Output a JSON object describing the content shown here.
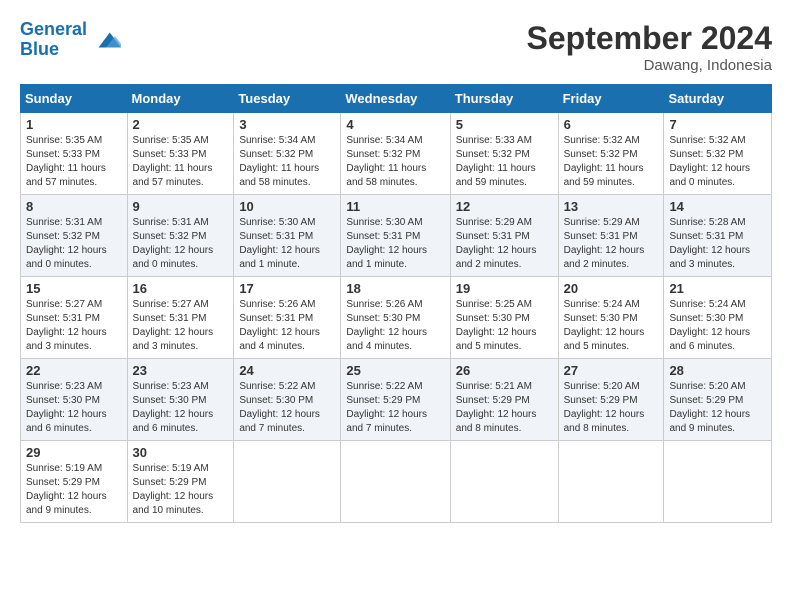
{
  "header": {
    "logo_line1": "General",
    "logo_line2": "Blue",
    "month": "September 2024",
    "location": "Dawang, Indonesia"
  },
  "days_of_week": [
    "Sunday",
    "Monday",
    "Tuesday",
    "Wednesday",
    "Thursday",
    "Friday",
    "Saturday"
  ],
  "weeks": [
    [
      {
        "day": "1",
        "info": "Sunrise: 5:35 AM\nSunset: 5:33 PM\nDaylight: 11 hours\nand 57 minutes."
      },
      {
        "day": "2",
        "info": "Sunrise: 5:35 AM\nSunset: 5:33 PM\nDaylight: 11 hours\nand 57 minutes."
      },
      {
        "day": "3",
        "info": "Sunrise: 5:34 AM\nSunset: 5:32 PM\nDaylight: 11 hours\nand 58 minutes."
      },
      {
        "day": "4",
        "info": "Sunrise: 5:34 AM\nSunset: 5:32 PM\nDaylight: 11 hours\nand 58 minutes."
      },
      {
        "day": "5",
        "info": "Sunrise: 5:33 AM\nSunset: 5:32 PM\nDaylight: 11 hours\nand 59 minutes."
      },
      {
        "day": "6",
        "info": "Sunrise: 5:32 AM\nSunset: 5:32 PM\nDaylight: 11 hours\nand 59 minutes."
      },
      {
        "day": "7",
        "info": "Sunrise: 5:32 AM\nSunset: 5:32 PM\nDaylight: 12 hours\nand 0 minutes."
      }
    ],
    [
      {
        "day": "8",
        "info": "Sunrise: 5:31 AM\nSunset: 5:32 PM\nDaylight: 12 hours\nand 0 minutes."
      },
      {
        "day": "9",
        "info": "Sunrise: 5:31 AM\nSunset: 5:32 PM\nDaylight: 12 hours\nand 0 minutes."
      },
      {
        "day": "10",
        "info": "Sunrise: 5:30 AM\nSunset: 5:31 PM\nDaylight: 12 hours\nand 1 minute."
      },
      {
        "day": "11",
        "info": "Sunrise: 5:30 AM\nSunset: 5:31 PM\nDaylight: 12 hours\nand 1 minute."
      },
      {
        "day": "12",
        "info": "Sunrise: 5:29 AM\nSunset: 5:31 PM\nDaylight: 12 hours\nand 2 minutes."
      },
      {
        "day": "13",
        "info": "Sunrise: 5:29 AM\nSunset: 5:31 PM\nDaylight: 12 hours\nand 2 minutes."
      },
      {
        "day": "14",
        "info": "Sunrise: 5:28 AM\nSunset: 5:31 PM\nDaylight: 12 hours\nand 3 minutes."
      }
    ],
    [
      {
        "day": "15",
        "info": "Sunrise: 5:27 AM\nSunset: 5:31 PM\nDaylight: 12 hours\nand 3 minutes."
      },
      {
        "day": "16",
        "info": "Sunrise: 5:27 AM\nSunset: 5:31 PM\nDaylight: 12 hours\nand 3 minutes."
      },
      {
        "day": "17",
        "info": "Sunrise: 5:26 AM\nSunset: 5:31 PM\nDaylight: 12 hours\nand 4 minutes."
      },
      {
        "day": "18",
        "info": "Sunrise: 5:26 AM\nSunset: 5:30 PM\nDaylight: 12 hours\nand 4 minutes."
      },
      {
        "day": "19",
        "info": "Sunrise: 5:25 AM\nSunset: 5:30 PM\nDaylight: 12 hours\nand 5 minutes."
      },
      {
        "day": "20",
        "info": "Sunrise: 5:24 AM\nSunset: 5:30 PM\nDaylight: 12 hours\nand 5 minutes."
      },
      {
        "day": "21",
        "info": "Sunrise: 5:24 AM\nSunset: 5:30 PM\nDaylight: 12 hours\nand 6 minutes."
      }
    ],
    [
      {
        "day": "22",
        "info": "Sunrise: 5:23 AM\nSunset: 5:30 PM\nDaylight: 12 hours\nand 6 minutes."
      },
      {
        "day": "23",
        "info": "Sunrise: 5:23 AM\nSunset: 5:30 PM\nDaylight: 12 hours\nand 6 minutes."
      },
      {
        "day": "24",
        "info": "Sunrise: 5:22 AM\nSunset: 5:30 PM\nDaylight: 12 hours\nand 7 minutes."
      },
      {
        "day": "25",
        "info": "Sunrise: 5:22 AM\nSunset: 5:29 PM\nDaylight: 12 hours\nand 7 minutes."
      },
      {
        "day": "26",
        "info": "Sunrise: 5:21 AM\nSunset: 5:29 PM\nDaylight: 12 hours\nand 8 minutes."
      },
      {
        "day": "27",
        "info": "Sunrise: 5:20 AM\nSunset: 5:29 PM\nDaylight: 12 hours\nand 8 minutes."
      },
      {
        "day": "28",
        "info": "Sunrise: 5:20 AM\nSunset: 5:29 PM\nDaylight: 12 hours\nand 9 minutes."
      }
    ],
    [
      {
        "day": "29",
        "info": "Sunrise: 5:19 AM\nSunset: 5:29 PM\nDaylight: 12 hours\nand 9 minutes."
      },
      {
        "day": "30",
        "info": "Sunrise: 5:19 AM\nSunset: 5:29 PM\nDaylight: 12 hours\nand 10 minutes."
      },
      {
        "day": "",
        "info": ""
      },
      {
        "day": "",
        "info": ""
      },
      {
        "day": "",
        "info": ""
      },
      {
        "day": "",
        "info": ""
      },
      {
        "day": "",
        "info": ""
      }
    ]
  ]
}
